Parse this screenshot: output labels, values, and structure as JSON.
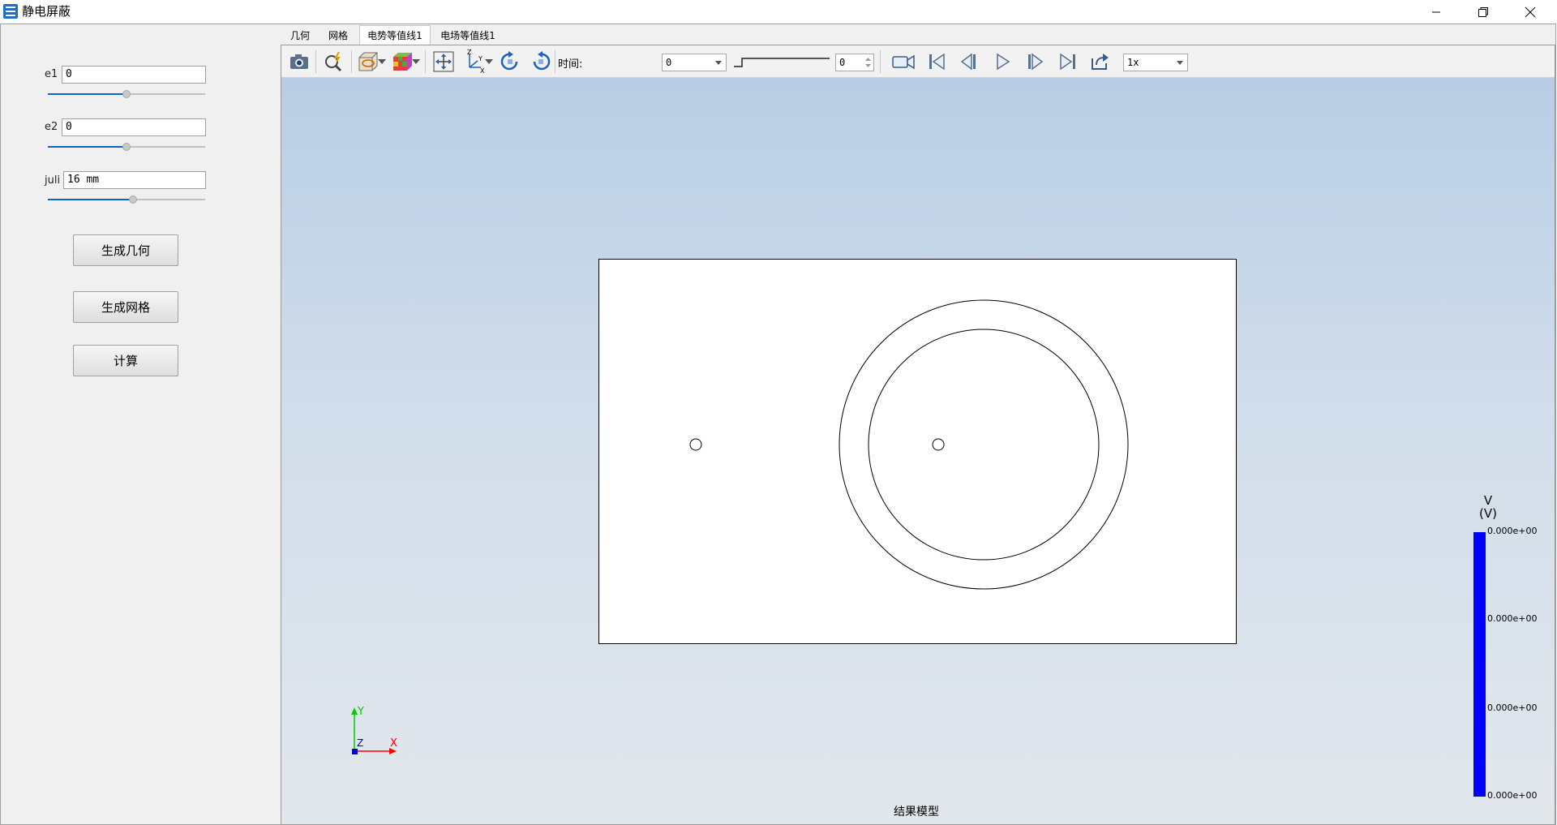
{
  "window": {
    "title": "静电屏蔽"
  },
  "params": [
    {
      "label": "e1",
      "value": "0",
      "slider": 0.5
    },
    {
      "label": "e2",
      "value": "0",
      "slider": 0.5
    },
    {
      "label": "juli",
      "value": "16 mm",
      "slider": 0.54
    }
  ],
  "buttons": {
    "geometry": "生成几何",
    "mesh": "生成网格",
    "compute": "计算"
  },
  "tabs": [
    "几何",
    "网格",
    "电势等值线1",
    "电场等值线1"
  ],
  "toolbar": {
    "time_label": "时间:",
    "time_value": "0",
    "frame_value": "0",
    "speed_value": "1x"
  },
  "legend": {
    "title": "V",
    "unit": "(V)",
    "ticks": [
      "0.000e+00",
      "0.000e+00",
      "0.000e+00",
      "0.000e+00"
    ],
    "color": "#0000ff"
  },
  "axes": {
    "x": "X",
    "y": "Y",
    "z": "Z"
  },
  "viewport": {
    "caption": "结果模型"
  }
}
